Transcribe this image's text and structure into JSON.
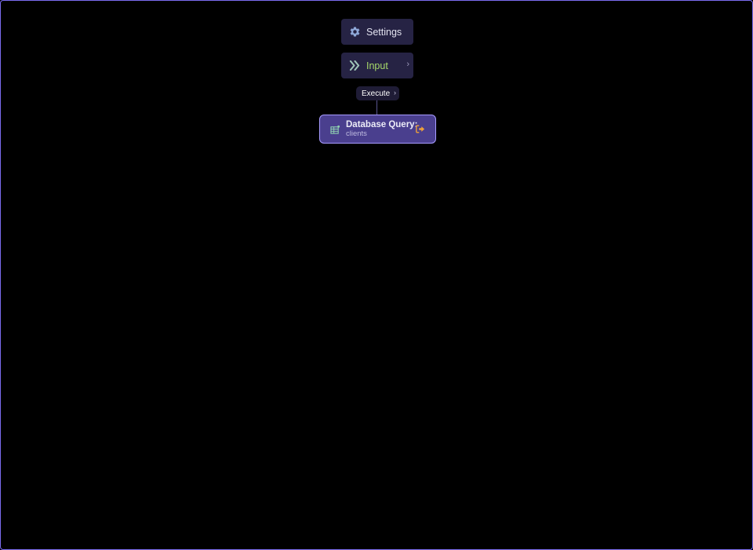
{
  "nodes": {
    "settings": {
      "label": "Settings",
      "icon": "gear-icon"
    },
    "input": {
      "label": "Input",
      "icon": "double-chevron-right-icon",
      "chevron": "›"
    },
    "execute": {
      "label": "Execute",
      "chevron": "›"
    },
    "db_query": {
      "title": "Database Query:",
      "subtitle": "clients",
      "icon": "database-table-icon",
      "action_icon": "exit-icon"
    }
  },
  "colors": {
    "border_accent": "#7b6cf0",
    "node_bg": "#262344",
    "input_label": "#a6d96a",
    "db_node_bg": "#4a3f8e",
    "db_node_border": "#a79bff",
    "exit_icon": "#f0a23a"
  }
}
